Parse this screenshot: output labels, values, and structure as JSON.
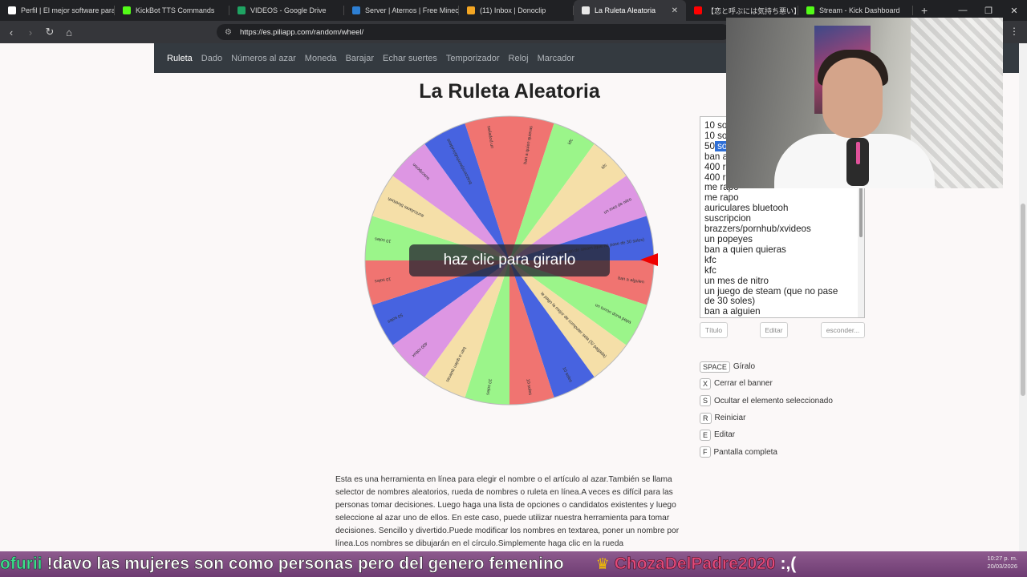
{
  "browser": {
    "tabs": [
      {
        "title": "Perfil | El mejor software para p",
        "color": "#ffffff",
        "width": 143
      },
      {
        "title": "KickBot TTS Commands",
        "color": "#53fc18",
        "width": 143
      },
      {
        "title": "VIDEOS - Google Drive",
        "color": "#1fa463",
        "width": 143
      },
      {
        "title": "Server | Aternos | Free Minecra",
        "color": "#2d7fd3",
        "width": 143
      },
      {
        "title": "(11) Inbox | Donoclip",
        "color": "#f4a623",
        "width": 143
      },
      {
        "title": "La Ruleta Aleatoria",
        "color": "#e8e8e8",
        "width": 140,
        "active": true
      },
      {
        "title": "【恋と呼ぶには気持ち悪い】O",
        "color": "#ff0000",
        "width": 140
      },
      {
        "title": "Stream - Kick Dashboard",
        "color": "#53fc18",
        "width": 143
      }
    ],
    "url": "https://es.piliapp.com/random/wheel/"
  },
  "nav": {
    "items": [
      "Ruleta",
      "Dado",
      "Números al azar",
      "Moneda",
      "Barajar",
      "Echar suertes",
      "Temporizador",
      "Reloj",
      "Marcador"
    ],
    "active_index": 0
  },
  "page": {
    "title": "La Ruleta Aleatoria",
    "spin_label": "haz clic para girarlo",
    "description": "Esta es una herramienta en línea para elegir el nombre o el artículo al azar.También se llama selector de nombres aleatorios, rueda de nombres o ruleta en línea.A veces es difícil para las personas tomar decisiones. Luego haga una lista de opciones o candidatos existentes y luego seleccione al azar uno de ellos. En este caso, puede utilizar nuestra herramienta para tomar decisiones. Sencillo y divertido.Puede modificar los nombres en textarea, poner un nombre por línea.Los nombres se dibujarán en el círculo.Simplemente haga clic en la rueda"
  },
  "wheel": {
    "colors": [
      "#f07471",
      "#9bf58a",
      "#f5dfa8",
      "#dd96e3",
      "#4763e0"
    ],
    "segments": [
      {
        "label": "ban a quien quieras",
        "color": "#f07471"
      },
      {
        "label": "kfc",
        "color": "#9bf58a"
      },
      {
        "label": "kfc",
        "color": "#f5dfa8"
      },
      {
        "label": "un mes de nitro",
        "color": "#dd96e3"
      },
      {
        "label": "un juego de steam (que no pase de 30 soles)",
        "color": "#4763e0"
      },
      {
        "label": "ban a alguien",
        "color": "#f07471"
      },
      {
        "label": "un turron dona pepa",
        "color": "#9bf58a"
      },
      {
        "label": "le pago la mejor de computer sela (S/ pagada)",
        "color": "#f5dfa8"
      },
      {
        "label": "10 soles",
        "color": "#4763e0"
      },
      {
        "label": "10 soles",
        "color": "#f07471"
      },
      {
        "label": "10 soles",
        "color": "#9bf58a"
      },
      {
        "label": "ban a quien quieras",
        "color": "#f5dfa8"
      },
      {
        "label": "400 robux",
        "color": "#dd96e3"
      },
      {
        "label": "50 soles",
        "color": "#4763e0"
      },
      {
        "label": "10 soles",
        "color": "#f07471"
      },
      {
        "label": "10 soles",
        "color": "#9bf58a"
      },
      {
        "label": "auriculares bluetooh",
        "color": "#f5dfa8"
      },
      {
        "label": "suscripcion",
        "color": "#dd96e3"
      },
      {
        "label": "brazzers/pornhub/xvideos",
        "color": "#4763e0"
      },
      {
        "label": "un popeyes",
        "color": "#f07471"
      }
    ]
  },
  "names": {
    "lines": [
      "10 soles",
      "10 soles",
      "50 soles",
      "ban a quien quieras",
      "400 robux",
      "400 robux",
      "me rapo",
      "me rapo",
      "auriculares bluetooh",
      "suscripcion",
      "brazzers/pornhub/xvideos",
      "un popeyes",
      "ban a quien quieras",
      "kfc",
      "kfc",
      "un mes de nitro",
      "un juego de steam (que no pase",
      "de 30 soles)",
      "ban a alguien"
    ],
    "visible_lines": [
      "10 so",
      "10 so",
      "50 so",
      "ban a",
      "400 r",
      "400 r",
      "me rapo",
      "me rapo",
      "auriculares bluetooh",
      "suscripcion",
      "brazzers/pornhub/xvideos",
      "un popeyes",
      "ban a quien quieras",
      "kfc",
      "kfc",
      "un mes de nitro",
      "un juego de steam (que no pase",
      "de 30 soles)",
      "ban a alguien"
    ],
    "selected_line_index": 2
  },
  "buttons": {
    "title": "Título",
    "edit": "Editar",
    "hide": "esconder..."
  },
  "shortcuts": [
    {
      "key": "SPACE",
      "label": "Gíralo"
    },
    {
      "key": "X",
      "label": "Cerrar el banner"
    },
    {
      "key": "S",
      "label": "Ocultar el elemento seleccionado"
    },
    {
      "key": "R",
      "label": "Reiniciar"
    },
    {
      "key": "E",
      "label": "Editar"
    },
    {
      "key": "F",
      "label": "Pantalla completa"
    }
  ],
  "stream_chat": {
    "user1": "ofurii",
    "msg1": "!davo las mujeres son como personas pero del genero femenino",
    "user2": "ChozaDelPadre2020",
    "msg2": ":,("
  },
  "clock": {
    "time": "10:27 p. m.",
    "date": "20/03/2026"
  }
}
